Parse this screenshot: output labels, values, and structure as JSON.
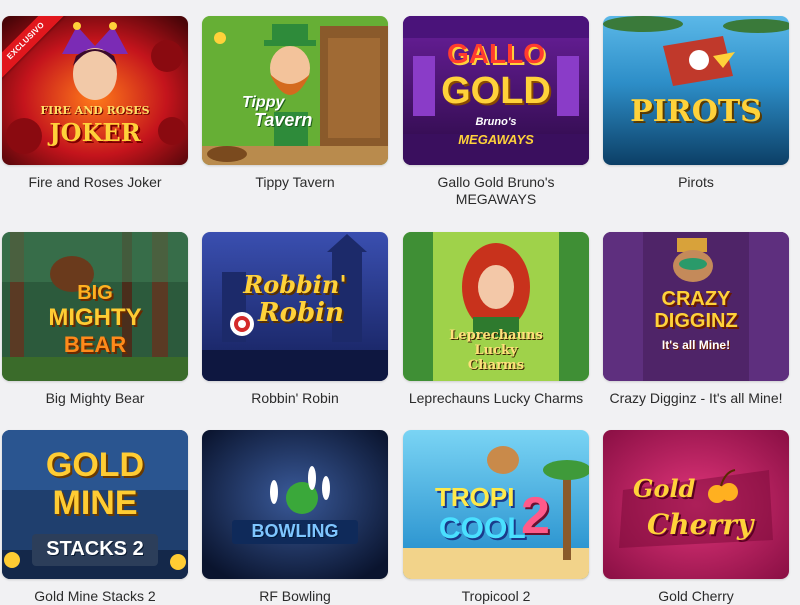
{
  "games": [
    {
      "id": "fire-roses-joker",
      "title": "Fire and Roses Joker",
      "badge": "EXCLUSIVO",
      "logo_top": "FIRE AND ROSES",
      "logo_main": "JOKER",
      "accent": "#b5121b"
    },
    {
      "id": "tippy-tavern",
      "title": "Tippy Tavern",
      "logo_top": "Tippy",
      "logo_main": "Tavern",
      "accent": "#6fb73a"
    },
    {
      "id": "gallo-gold",
      "title": "Gallo Gold Bruno's MEGAWAYS",
      "logo_top": "GALLO",
      "logo_main": "GOLD",
      "logo_sub": "Bruno's",
      "logo_sub2": "MEGAWAYS",
      "accent": "#8b2fb5"
    },
    {
      "id": "pirots",
      "title": "Pirots",
      "logo_main": "PIROTS",
      "accent": "#1f6fa8"
    },
    {
      "id": "big-mighty-bear",
      "title": "Big Mighty Bear",
      "logo_top": "BIG",
      "logo_main": "MIGHTY",
      "logo_sub": "BEAR",
      "accent": "#2f6b45"
    },
    {
      "id": "robbin-robin",
      "title": "Robbin' Robin",
      "logo_top": "Robbin'",
      "logo_main": "Robin",
      "accent": "#26388c"
    },
    {
      "id": "leprechauns-lucky-charms",
      "title": "Leprechauns Lucky Charms",
      "logo_top": "Leprechauns",
      "logo_main": "Lucky",
      "logo_sub": "Charms",
      "accent": "#3f8f35"
    },
    {
      "id": "crazy-digginz",
      "title": "Crazy Digginz - It's all Mine!",
      "logo_top": "CRAZY",
      "logo_main": "DIGGINZ",
      "logo_sub": "It's all Mine!",
      "accent": "#5b2a7a"
    },
    {
      "id": "gold-mine-stacks-2",
      "title": "Gold Mine Stacks 2",
      "logo_top": "GOLD",
      "logo_main": "MINE",
      "logo_sub": "STACKS 2",
      "accent": "#1e3d6b"
    },
    {
      "id": "rf-bowling",
      "title": "RF Bowling",
      "logo_main": "BOWLING",
      "accent": "#1c2a4a"
    },
    {
      "id": "tropicool-2",
      "title": "Tropicool 2",
      "logo_top": "TROPI",
      "logo_main": "COOL",
      "logo_sub": "2",
      "accent": "#2a9fd6"
    },
    {
      "id": "gold-cherry",
      "title": "Gold Cherry",
      "logo_top": "Gold",
      "logo_main": "Cherry",
      "accent": "#c2185b"
    }
  ]
}
